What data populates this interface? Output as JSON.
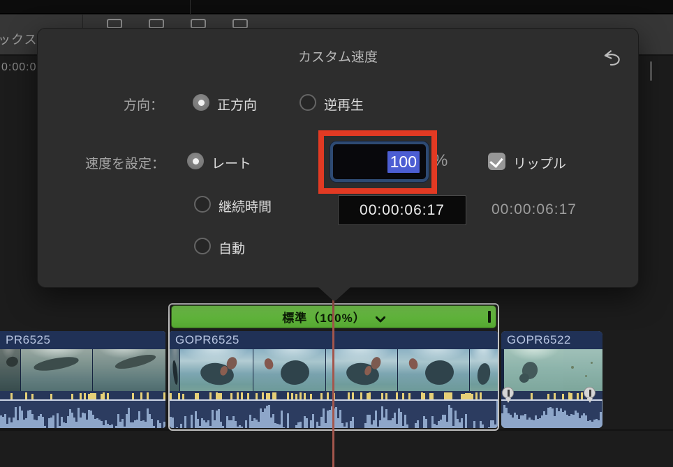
{
  "chrome": {
    "toolbar_text": "ックス",
    "timecode_partial": "0:00:0"
  },
  "popover": {
    "title": "カスタム速度",
    "direction": {
      "label": "方向：",
      "options": [
        {
          "label": "正方向",
          "selected": true
        },
        {
          "label": "逆再生",
          "selected": false
        }
      ]
    },
    "speed": {
      "label": "速度を設定：",
      "rate_option": "レート",
      "duration_option": "継続時間",
      "auto_option": "自動",
      "rate_value": "100",
      "rate_unit": "%",
      "ripple_label": "リップル",
      "ripple_checked": true,
      "duration_value": "00:00:06:17",
      "duration_readout": "00:00:06:17"
    }
  },
  "timeline": {
    "speed_bar_label": "標準（100%）",
    "clips": [
      {
        "name": "PR6525"
      },
      {
        "name": "GOPR6525"
      },
      {
        "name": "GOPR6522"
      }
    ]
  },
  "colors": {
    "annotation_red": "#e23a23",
    "selection_blue": "#4c5ed3",
    "speed_bar_green": "#62b83c",
    "clip_header_navy": "#203156",
    "waveform_light": "#8ea6c9",
    "waveform_dark": "#2c3c60",
    "playhead_red": "#a3564c"
  }
}
